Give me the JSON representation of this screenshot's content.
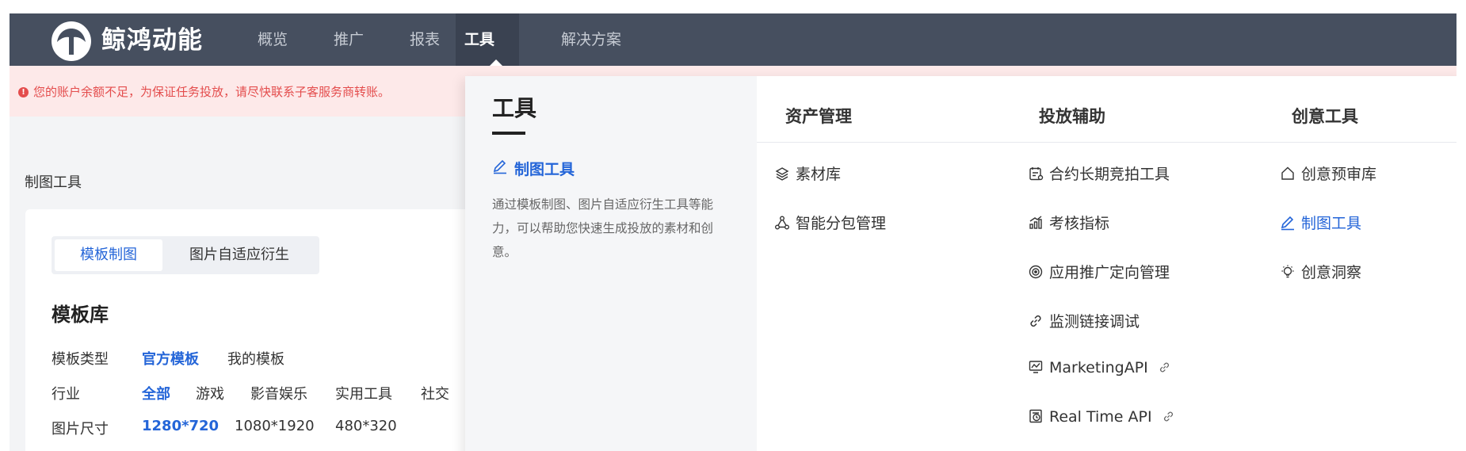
{
  "brand": {
    "name": "鲸鸿动能",
    "logo_icon": "whale-logo-icon"
  },
  "nav": {
    "items": [
      {
        "label": "概览"
      },
      {
        "label": "推广"
      },
      {
        "label": "报表"
      },
      {
        "label": "工具"
      },
      {
        "label": "解决方案"
      }
    ],
    "active": "工具"
  },
  "alert": {
    "icon": "exclamation-circle-icon",
    "text": "您的账户余额不足，为保证任务投放，请尽快联系子客服务商转账。"
  },
  "page": {
    "title": "制图工具"
  },
  "card": {
    "tabs": [
      {
        "label": "模板制图"
      },
      {
        "label": "图片自适应衍生"
      }
    ],
    "library_title": "模板库",
    "filters": {
      "type": {
        "label": "模板类型",
        "options": [
          "官方模板",
          "我的模板"
        ],
        "selected": "官方模板"
      },
      "industry": {
        "label": "行业",
        "options": [
          "全部",
          "游戏",
          "影音娱乐",
          "实用工具",
          "社交"
        ],
        "selected": "全部"
      },
      "size": {
        "label": "图片尺寸",
        "options": [
          "1280*720",
          "1080*1920",
          "480*320"
        ],
        "selected": "1280*720"
      }
    }
  },
  "dropdown": {
    "title": "工具",
    "featured": {
      "icon": "pencil-icon",
      "label": "制图工具",
      "description": "通过模板制图、图片自适应衍生工具等能力，可以帮助您快速生成投放的素材和创意。"
    },
    "columns": [
      {
        "header": "资产管理",
        "items": [
          {
            "icon": "layers-icon",
            "label": "素材库"
          },
          {
            "icon": "hierarchy-icon",
            "label": "智能分包管理"
          }
        ]
      },
      {
        "header": "投放辅助",
        "items": [
          {
            "icon": "contract-icon",
            "label": "合约长期竞拍工具"
          },
          {
            "icon": "bar-chart-icon",
            "label": "考核指标"
          },
          {
            "icon": "target-icon",
            "label": "应用推广定向管理"
          },
          {
            "icon": "link-icon",
            "label": "监测链接调试"
          },
          {
            "icon": "monitor-chart-icon",
            "label": "MarketingAPI",
            "external": true
          },
          {
            "icon": "clock-doc-icon",
            "label": "Real Time API",
            "external": true
          }
        ]
      },
      {
        "header": "创意工具",
        "items": [
          {
            "icon": "home-icon",
            "label": "创意预审库"
          },
          {
            "icon": "pencil-icon",
            "label": "制图工具",
            "active": true
          },
          {
            "icon": "bulb-icon",
            "label": "创意洞察"
          }
        ]
      }
    ]
  },
  "colors": {
    "nav_bg": "#464f5f",
    "accent": "#2465d8",
    "alert_text": "#e44d4d",
    "alert_bg": "#fde9e9"
  }
}
